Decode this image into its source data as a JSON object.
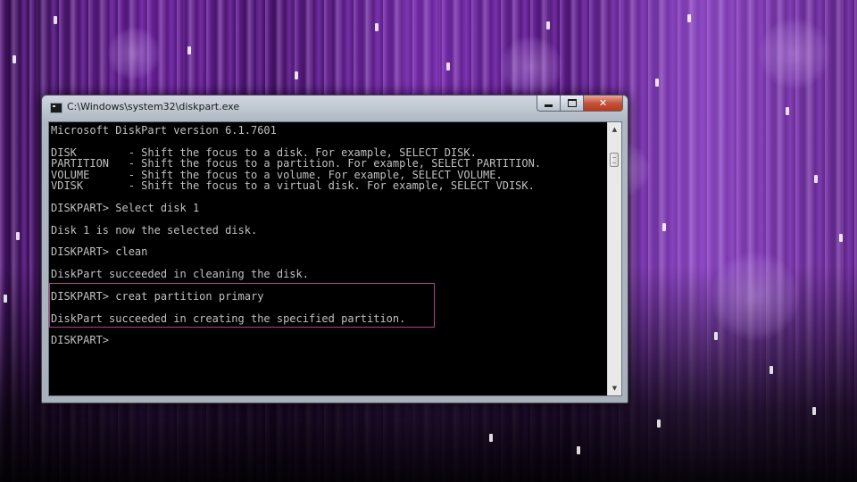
{
  "window": {
    "title": "C:\\Windows\\system32\\diskpart.exe",
    "controls": {
      "minimize": "minimize",
      "maximize": "maximize",
      "close_glyph": "✕"
    }
  },
  "console": {
    "lines": [
      "Microsoft DiskPart version 6.1.7601",
      "",
      "DISK        - Shift the focus to a disk. For example, SELECT DISK.",
      "PARTITION   - Shift the focus to a partition. For example, SELECT PARTITION.",
      "VOLUME      - Shift the focus to a volume. For example, SELECT VOLUME.",
      "VDISK       - Shift the focus to a virtual disk. For example, SELECT VDISK.",
      "",
      "DISKPART> Select disk 1",
      "",
      "Disk 1 is now the selected disk.",
      "",
      "DISKPART> clean",
      "",
      "DiskPart succeeded in cleaning the disk.",
      "",
      "DISKPART> creat partition primary",
      "",
      "DiskPart succeeded in creating the specified partition.",
      "",
      "DISKPART> "
    ]
  },
  "scrollbar": {
    "up_glyph": "▲",
    "down_glyph": "▼"
  },
  "colors": {
    "console_bg": "#000000",
    "console_text": "#c0c0c0",
    "highlight": "#b0428a",
    "close_button": "#c5533a"
  },
  "icons": {
    "app": "console-app-icon",
    "minimize": "minimize-icon",
    "maximize": "maximize-icon",
    "close": "close-icon",
    "scroll_up": "chevron-up-icon",
    "scroll_down": "chevron-down-icon"
  }
}
